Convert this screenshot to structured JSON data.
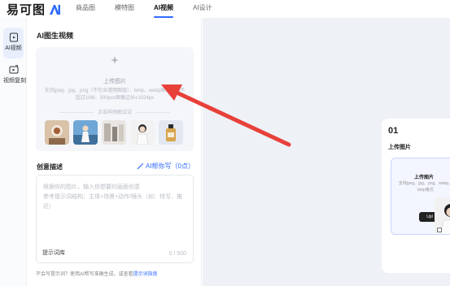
{
  "app": {
    "logo_text": "易可图",
    "brand_color": "#2f6bff"
  },
  "nav": {
    "items": [
      {
        "label": "商品图",
        "active": false
      },
      {
        "label": "模特图",
        "active": false
      },
      {
        "label": "AI视频",
        "active": true
      },
      {
        "label": "AI设计",
        "active": false
      }
    ]
  },
  "rail": {
    "items": [
      {
        "label": "AI视频",
        "icon": "video-doc-icon",
        "active": true
      },
      {
        "label": "视频复刻",
        "icon": "video-copy-icon",
        "active": false
      }
    ]
  },
  "panel": {
    "title": "AI图生视频",
    "upload": {
      "plus": "+",
      "label": "上传图片",
      "hint": "支持jpeg、jpg、png（不包含透明图层）、bmp、webp格式大小不超过10M、300px≤图像边长≤1024px"
    },
    "examples": {
      "title": "点击样例图试试",
      "thumbs": [
        "example-1",
        "example-2",
        "example-3",
        "example-4",
        "example-5"
      ]
    },
    "description": {
      "title": "创意描述",
      "ai_write": "AI帮你写（0点）",
      "placeholder": "根据你的图片，输入你想要的画面创意\n参考提示词结构：主体+场景+动作/镜头（如：特写、推近）",
      "prompt_library": "提示词库",
      "counter": "0 / 500"
    },
    "footer": {
      "text": "不会写提示词？使用AI帮写准确生成，或查看",
      "link": "提示词指南"
    }
  },
  "canvas": {
    "step": {
      "number": "01",
      "label": "上传图片",
      "mini_title": "上传图片",
      "mini_hint": "支持jpeg、jpg、png、webp、bmp格式",
      "mini_button": "Upl"
    }
  },
  "colors": {
    "accent": "#2f6bff",
    "arrow": "#e8403a",
    "canvas_bg": "#eef1f6"
  }
}
